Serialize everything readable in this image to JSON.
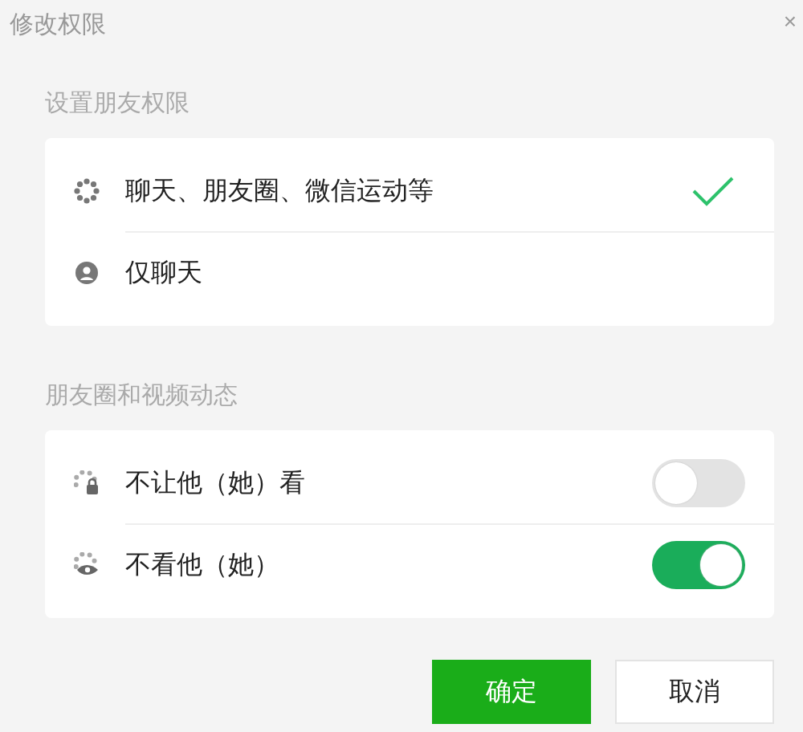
{
  "window": {
    "title": "修改权限",
    "close": "×"
  },
  "sections": [
    {
      "heading": "设置朋友权限",
      "kind": "choice",
      "items": [
        {
          "label": "聊天、朋友圈、微信运动等",
          "selected": true
        },
        {
          "label": "仅聊天",
          "selected": false
        }
      ]
    },
    {
      "heading": "朋友圈和视频动态",
      "kind": "toggle",
      "items": [
        {
          "label": "不让他（她）看",
          "on": false
        },
        {
          "label": "不看他（她）",
          "on": true
        }
      ]
    }
  ],
  "buttons": [
    {
      "label": "确定",
      "kind": "primary"
    },
    {
      "label": "取消",
      "kind": "secondary"
    }
  ]
}
